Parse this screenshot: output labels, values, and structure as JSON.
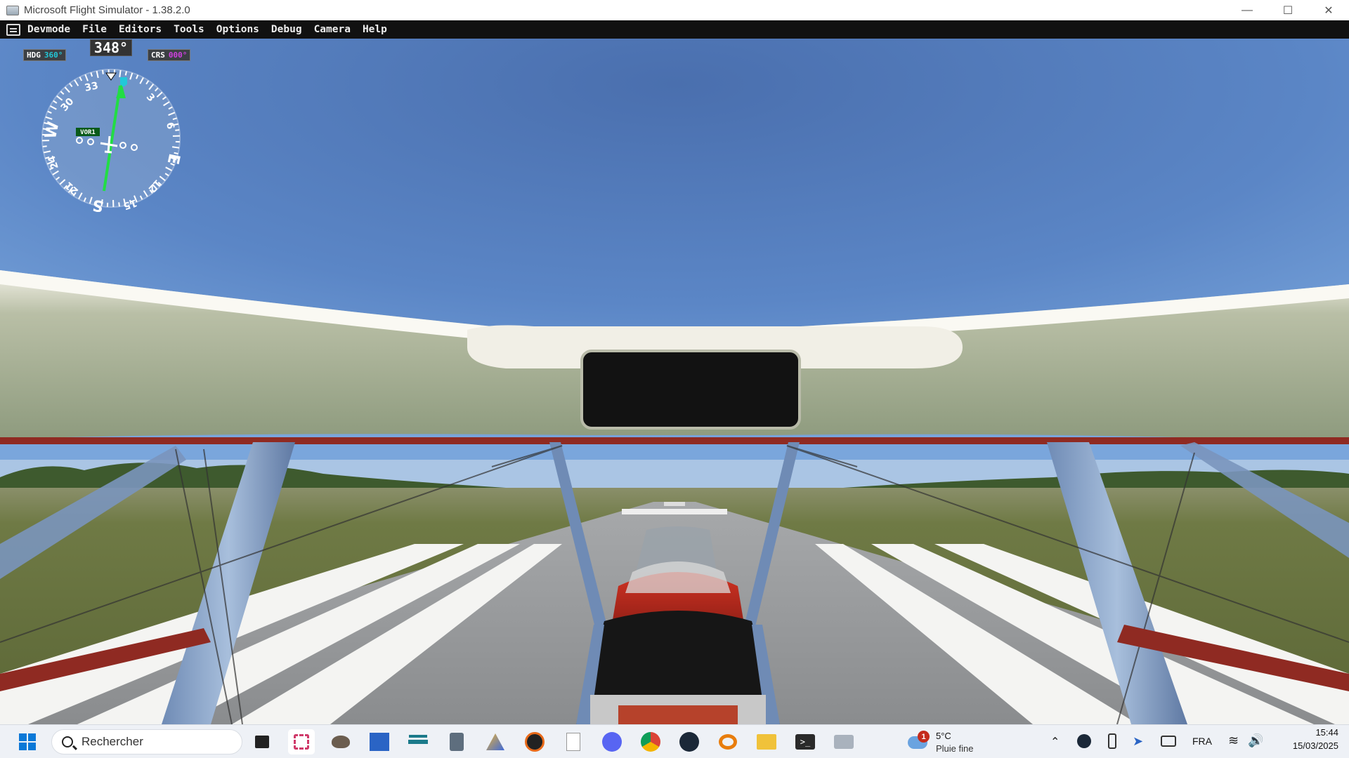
{
  "window": {
    "title": "Microsoft Flight Simulator - 1.38.2.0",
    "minimize_icon": "minimize-icon",
    "maximize_icon": "maximize-icon",
    "close_icon": "close-icon"
  },
  "devbar": {
    "menus": [
      "Devmode",
      "File",
      "Editors",
      "Tools",
      "Options",
      "Debug",
      "Camera",
      "Help"
    ]
  },
  "hud": {
    "heading_readout": "348°",
    "hdg_label": "HDG",
    "hdg_value": "360°",
    "crs_label": "CRS",
    "crs_value": "000°",
    "vor_label": "VOR1",
    "compass_labels": [
      "33",
      "3",
      "6",
      "E",
      "12",
      "15",
      "S",
      "21",
      "24",
      "W",
      "30"
    ],
    "colors": {
      "hdg_value": "#22c8d8",
      "crs_value": "#d040e0",
      "needle": "#22dd44",
      "bug": "#22c8d8"
    }
  },
  "taskbar": {
    "search_placeholder": "Rechercher",
    "weather_temp": "5°C",
    "weather_desc": "Pluie fine",
    "weather_badge": "1",
    "language": "FRA",
    "time": "15:44",
    "date": "15/03/2025",
    "apps": [
      "task-view-icon",
      "snipping-tool-icon",
      "gimp-icon",
      "visual-studio-icon",
      "flight-simulator-icon",
      "calculator-icon",
      "office-icon",
      "obs-icon",
      "notepad-icon",
      "discord-icon",
      "chrome-icon",
      "steam-icon",
      "blender-icon",
      "file-explorer-icon",
      "terminal-icon",
      "dev-tools-icon"
    ]
  }
}
